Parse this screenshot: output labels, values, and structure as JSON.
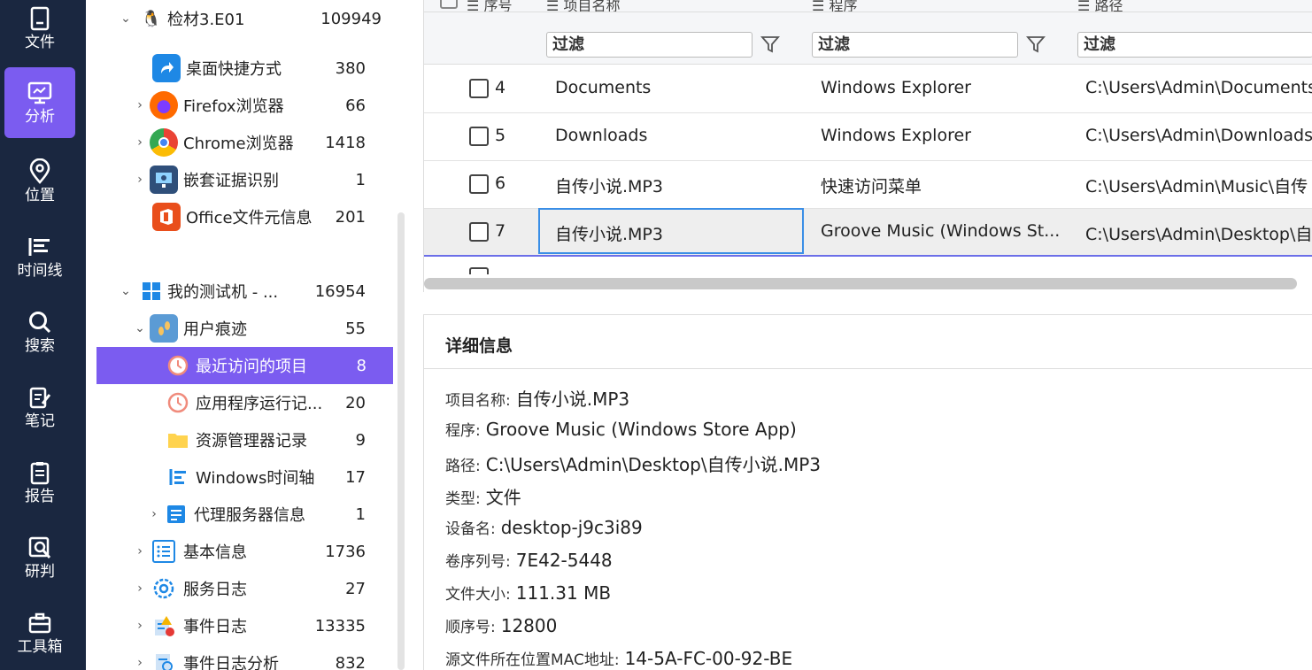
{
  "nav": [
    {
      "label": "文件",
      "icon": "file-icon"
    },
    {
      "label": "分析",
      "icon": "monitor-icon",
      "active": true
    },
    {
      "label": "位置",
      "icon": "location-icon"
    },
    {
      "label": "时间线",
      "icon": "timeline-icon"
    },
    {
      "label": "搜索",
      "icon": "search-icon"
    },
    {
      "label": "笔记",
      "icon": "note-icon"
    },
    {
      "label": "报告",
      "icon": "report-icon"
    },
    {
      "label": "研判",
      "icon": "analysis-icon"
    },
    {
      "label": "工具箱",
      "icon": "toolbox-icon"
    }
  ],
  "tree": [
    {
      "label": "检材3.E01",
      "count": "109949",
      "icon": "linux-icon"
    },
    {
      "label": "桌面快捷方式",
      "count": "380",
      "icon": "shortcut-icon"
    },
    {
      "label": "Firefox浏览器",
      "count": "66",
      "icon": "firefox-icon"
    },
    {
      "label": "Chrome浏览器",
      "count": "1418",
      "icon": "chrome-icon"
    },
    {
      "label": "嵌套证据识别",
      "count": "1",
      "icon": "nested-evidence-icon"
    },
    {
      "label": "Office文件元信息",
      "count": "201",
      "icon": "office-icon"
    },
    {
      "label": "我的测试机 - ...",
      "count": "16954",
      "icon": "windows-icon"
    },
    {
      "label": "用户痕迹",
      "count": "55",
      "icon": "footprint-icon"
    },
    {
      "label": "最近访问的项目",
      "count": "8",
      "icon": "clock-icon"
    },
    {
      "label": "应用程序运行记...",
      "count": "20",
      "icon": "clock-icon"
    },
    {
      "label": "资源管理器记录",
      "count": "9",
      "icon": "folder-icon"
    },
    {
      "label": "Windows时间轴",
      "count": "17",
      "icon": "timeline-list-icon"
    },
    {
      "label": "代理服务器信息",
      "count": "1",
      "icon": "proxy-icon"
    },
    {
      "label": "基本信息",
      "count": "1736",
      "icon": "list-icon"
    },
    {
      "label": "服务日志",
      "count": "27",
      "icon": "gear-icon"
    },
    {
      "label": "事件日志",
      "count": "13335",
      "icon": "event-log-icon"
    },
    {
      "label": "事件日志分析",
      "count": "832",
      "icon": "event-analysis-icon"
    }
  ],
  "grid": {
    "headers": [
      "序号",
      "项目名称",
      "程序",
      "路径"
    ],
    "filter_placeholder": "过滤",
    "rows": [
      {
        "num": "4",
        "name": "Documents",
        "program": "Windows Explorer",
        "path": "C:\\Users\\Admin\\Documents"
      },
      {
        "num": "5",
        "name": "Downloads",
        "program": "Windows Explorer",
        "path": "C:\\Users\\Admin\\Downloads"
      },
      {
        "num": "6",
        "name": "自传小说.MP3",
        "program": "快速访问菜单",
        "path": "C:\\Users\\Admin\\Music\\自传"
      },
      {
        "num": "7",
        "name": "自传小说.MP3",
        "program": "Groove Music (Windows St...",
        "path": "C:\\Users\\Admin\\Desktop\\自"
      }
    ]
  },
  "detail": {
    "title": "详细信息",
    "fields": [
      {
        "key": "项目名称:",
        "value": "自传小说.MP3"
      },
      {
        "key": "程序:",
        "value": "Groove Music (Windows Store App)"
      },
      {
        "key": "路径:",
        "value": "C:\\Users\\Admin\\Desktop\\自传小说.MP3"
      },
      {
        "key": "类型:",
        "value": "文件"
      },
      {
        "key": "设备名:",
        "value": "desktop-j9c3i89"
      },
      {
        "key": "卷序列号:",
        "value": "7E42-5448"
      },
      {
        "key": "文件大小:",
        "value": "111.31 MB"
      },
      {
        "key": "顺序号:",
        "value": "12800"
      },
      {
        "key": "源文件所在位置MAC地址:",
        "value": "14-5A-FC-00-92-BE"
      }
    ]
  },
  "colors": {
    "nav_bg": "#1a2740",
    "accent": "#7b5cf0",
    "focus": "#3a8ee6"
  }
}
